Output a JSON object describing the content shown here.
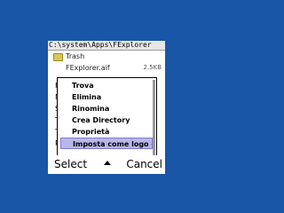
{
  "path": "C:\\system\\Apps\\FExplorer",
  "files": [
    {
      "name": "Trash",
      "size": ""
    },
    {
      "name": "FExplorer.aif",
      "size": "2.5KB"
    }
  ],
  "background_letters": [
    "F",
    "M",
    "S",
    "T",
    "T",
    "R"
  ],
  "menu": {
    "items": [
      {
        "label": "Trova"
      },
      {
        "label": "Elimina"
      },
      {
        "label": "Rinomina"
      },
      {
        "label": "Crea Directory"
      },
      {
        "label": "Proprietà"
      },
      {
        "label": "Imposta come logo o..."
      }
    ],
    "selected_index": 5
  },
  "softkeys": {
    "left": "Select",
    "right": "Cancel"
  },
  "colors": {
    "desktop": "#1a56a8",
    "highlight": "#b9b6e8"
  }
}
